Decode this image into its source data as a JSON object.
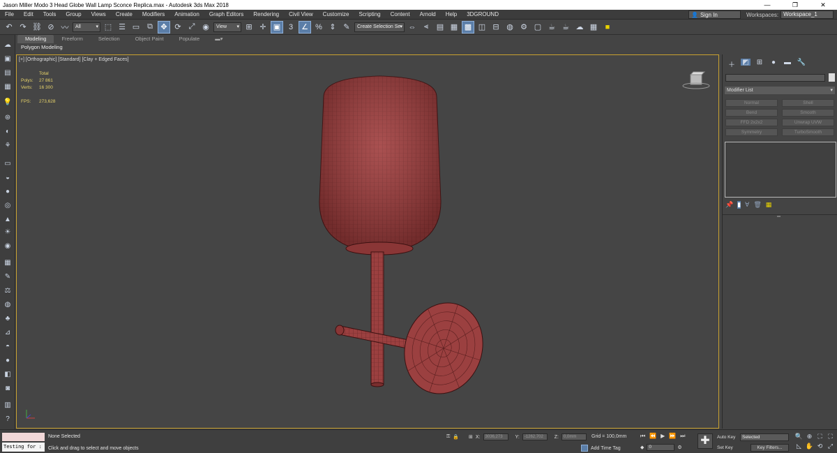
{
  "window": {
    "title": "Jason Miller Modo 3 Head Globe Wall Lamp Sconce Replica.max - Autodesk 3ds Max 2018",
    "buttons": [
      "—",
      "❐",
      "✕"
    ]
  },
  "menu": [
    "File",
    "Edit",
    "Tools",
    "Group",
    "Views",
    "Create",
    "Modifiers",
    "Animation",
    "Graph Editors",
    "Rendering",
    "Civil View",
    "Customize",
    "Scripting",
    "Content",
    "Arnold",
    "Help",
    "3DGROUND"
  ],
  "signin": "Sign In",
  "workspaces": {
    "label": "Workspaces:",
    "value": "Workspace_1"
  },
  "toolbar": {
    "filter": "All",
    "view_mode": "View",
    "selection_set": "Create Selection Se"
  },
  "ribbon": {
    "tabs": [
      "Modeling",
      "Freeform",
      "Selection",
      "Object Paint",
      "Populate"
    ],
    "active_tab": "Modeling",
    "subtitle": "Polygon Modeling"
  },
  "viewport": {
    "label": "[+] [Orthographic] [Standard] [Clay + Edged Faces]",
    "stats": {
      "header": "Total",
      "polys_label": "Polys:",
      "polys": "27 861",
      "verts_label": "Verts:",
      "verts": "16 300",
      "fps_label": "FPS:",
      "fps": "273,628"
    },
    "lamp_color": "#9b4040",
    "wire_color": "#5a1f1f"
  },
  "command_panel": {
    "modifier_list": "Modifier List",
    "modifiers": [
      "Normal",
      "Shell",
      "Bend",
      "Smooth",
      "FFD 2x2x2",
      "Unwrap UVW",
      "Symmetry",
      "TurboSmooth"
    ]
  },
  "status": {
    "listener_text": "Testing for :",
    "selection": "None Selected",
    "hint": "Click and drag to select and move objects",
    "x_label": "X:",
    "x_value": "3036,273",
    "y_label": "Y:",
    "y_value": "-1262,702",
    "z_label": "Z:",
    "z_value": "0,0mm",
    "grid": "Grid = 100,0mm",
    "add_time_tag": "Add Time Tag",
    "frame": "0",
    "auto_key": "Auto Key",
    "set_key": "Set Key",
    "selected": "Selected",
    "key_filters": "Key Filters..."
  }
}
